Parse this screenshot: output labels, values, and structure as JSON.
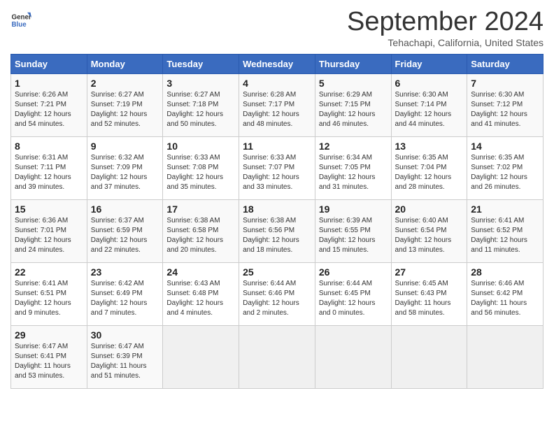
{
  "header": {
    "logo_line1": "General",
    "logo_line2": "Blue",
    "month": "September 2024",
    "location": "Tehachapi, California, United States"
  },
  "days_of_week": [
    "Sunday",
    "Monday",
    "Tuesday",
    "Wednesday",
    "Thursday",
    "Friday",
    "Saturday"
  ],
  "weeks": [
    [
      {
        "num": "1",
        "info": "Sunrise: 6:26 AM\nSunset: 7:21 PM\nDaylight: 12 hours\nand 54 minutes."
      },
      {
        "num": "2",
        "info": "Sunrise: 6:27 AM\nSunset: 7:19 PM\nDaylight: 12 hours\nand 52 minutes."
      },
      {
        "num": "3",
        "info": "Sunrise: 6:27 AM\nSunset: 7:18 PM\nDaylight: 12 hours\nand 50 minutes."
      },
      {
        "num": "4",
        "info": "Sunrise: 6:28 AM\nSunset: 7:17 PM\nDaylight: 12 hours\nand 48 minutes."
      },
      {
        "num": "5",
        "info": "Sunrise: 6:29 AM\nSunset: 7:15 PM\nDaylight: 12 hours\nand 46 minutes."
      },
      {
        "num": "6",
        "info": "Sunrise: 6:30 AM\nSunset: 7:14 PM\nDaylight: 12 hours\nand 44 minutes."
      },
      {
        "num": "7",
        "info": "Sunrise: 6:30 AM\nSunset: 7:12 PM\nDaylight: 12 hours\nand 41 minutes."
      }
    ],
    [
      {
        "num": "8",
        "info": "Sunrise: 6:31 AM\nSunset: 7:11 PM\nDaylight: 12 hours\nand 39 minutes."
      },
      {
        "num": "9",
        "info": "Sunrise: 6:32 AM\nSunset: 7:09 PM\nDaylight: 12 hours\nand 37 minutes."
      },
      {
        "num": "10",
        "info": "Sunrise: 6:33 AM\nSunset: 7:08 PM\nDaylight: 12 hours\nand 35 minutes."
      },
      {
        "num": "11",
        "info": "Sunrise: 6:33 AM\nSunset: 7:07 PM\nDaylight: 12 hours\nand 33 minutes."
      },
      {
        "num": "12",
        "info": "Sunrise: 6:34 AM\nSunset: 7:05 PM\nDaylight: 12 hours\nand 31 minutes."
      },
      {
        "num": "13",
        "info": "Sunrise: 6:35 AM\nSunset: 7:04 PM\nDaylight: 12 hours\nand 28 minutes."
      },
      {
        "num": "14",
        "info": "Sunrise: 6:35 AM\nSunset: 7:02 PM\nDaylight: 12 hours\nand 26 minutes."
      }
    ],
    [
      {
        "num": "15",
        "info": "Sunrise: 6:36 AM\nSunset: 7:01 PM\nDaylight: 12 hours\nand 24 minutes."
      },
      {
        "num": "16",
        "info": "Sunrise: 6:37 AM\nSunset: 6:59 PM\nDaylight: 12 hours\nand 22 minutes."
      },
      {
        "num": "17",
        "info": "Sunrise: 6:38 AM\nSunset: 6:58 PM\nDaylight: 12 hours\nand 20 minutes."
      },
      {
        "num": "18",
        "info": "Sunrise: 6:38 AM\nSunset: 6:56 PM\nDaylight: 12 hours\nand 18 minutes."
      },
      {
        "num": "19",
        "info": "Sunrise: 6:39 AM\nSunset: 6:55 PM\nDaylight: 12 hours\nand 15 minutes."
      },
      {
        "num": "20",
        "info": "Sunrise: 6:40 AM\nSunset: 6:54 PM\nDaylight: 12 hours\nand 13 minutes."
      },
      {
        "num": "21",
        "info": "Sunrise: 6:41 AM\nSunset: 6:52 PM\nDaylight: 12 hours\nand 11 minutes."
      }
    ],
    [
      {
        "num": "22",
        "info": "Sunrise: 6:41 AM\nSunset: 6:51 PM\nDaylight: 12 hours\nand 9 minutes."
      },
      {
        "num": "23",
        "info": "Sunrise: 6:42 AM\nSunset: 6:49 PM\nDaylight: 12 hours\nand 7 minutes."
      },
      {
        "num": "24",
        "info": "Sunrise: 6:43 AM\nSunset: 6:48 PM\nDaylight: 12 hours\nand 4 minutes."
      },
      {
        "num": "25",
        "info": "Sunrise: 6:44 AM\nSunset: 6:46 PM\nDaylight: 12 hours\nand 2 minutes."
      },
      {
        "num": "26",
        "info": "Sunrise: 6:44 AM\nSunset: 6:45 PM\nDaylight: 12 hours\nand 0 minutes."
      },
      {
        "num": "27",
        "info": "Sunrise: 6:45 AM\nSunset: 6:43 PM\nDaylight: 11 hours\nand 58 minutes."
      },
      {
        "num": "28",
        "info": "Sunrise: 6:46 AM\nSunset: 6:42 PM\nDaylight: 11 hours\nand 56 minutes."
      }
    ],
    [
      {
        "num": "29",
        "info": "Sunrise: 6:47 AM\nSunset: 6:41 PM\nDaylight: 11 hours\nand 53 minutes."
      },
      {
        "num": "30",
        "info": "Sunrise: 6:47 AM\nSunset: 6:39 PM\nDaylight: 11 hours\nand 51 minutes."
      },
      {
        "num": "",
        "info": ""
      },
      {
        "num": "",
        "info": ""
      },
      {
        "num": "",
        "info": ""
      },
      {
        "num": "",
        "info": ""
      },
      {
        "num": "",
        "info": ""
      }
    ]
  ]
}
